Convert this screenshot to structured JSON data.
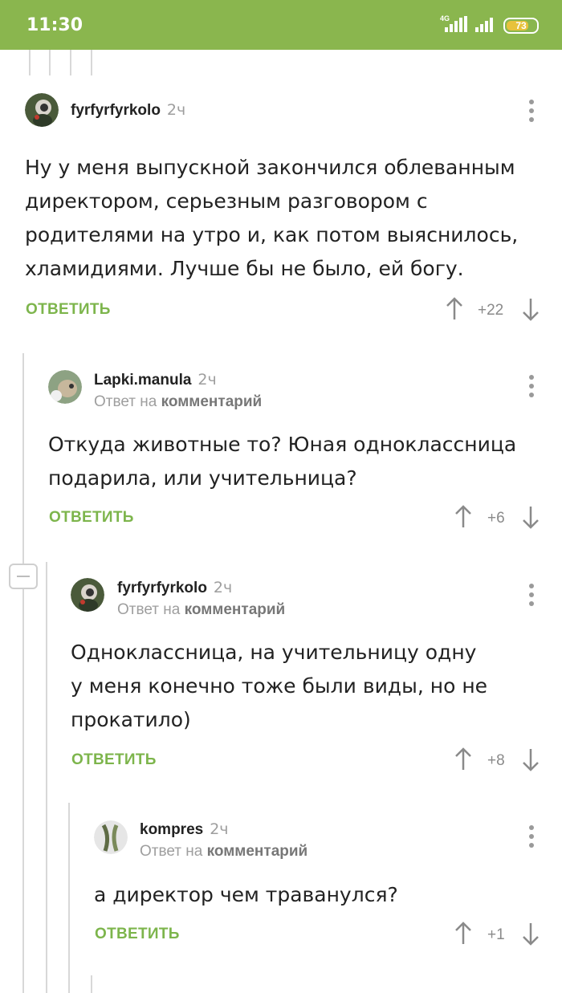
{
  "status": {
    "time": "11:30",
    "network": "4G",
    "battery": "73"
  },
  "comments": [
    {
      "user": "fyrfyrfyrkolo",
      "ago": "2ч",
      "reply_prefix": "",
      "reply_link": "",
      "text": [
        "Ну у меня выпускной закончился облеванным",
        "директором, серьезным разговором с",
        "родителями на утро и, как потом выяснилось,",
        "хламидиями. Лучше бы не было, ей богу."
      ],
      "answer": "ОТВЕТИТЬ",
      "rating": "+22"
    },
    {
      "user": "Lapki.manula",
      "ago": "2ч",
      "reply_prefix": "Ответ на",
      "reply_link": "комментарий",
      "text": [
        "Откуда животные то? Юная одноклассница",
        "подарила, или учительница?"
      ],
      "answer": "ОТВЕТИТЬ",
      "rating": "+6"
    },
    {
      "user": "fyrfyrfyrkolo",
      "ago": "2ч",
      "reply_prefix": "Ответ на",
      "reply_link": "комментарий",
      "text": [
        "Одноклассница, на учительницу одну",
        "у меня конечно тоже были виды, но не",
        "прокатило)"
      ],
      "answer": "ОТВЕТИТЬ",
      "rating": "+8"
    },
    {
      "user": "kompres",
      "ago": "2ч",
      "reply_prefix": "Ответ на",
      "reply_link": "комментарий",
      "text": [
        "а директор чем траванулся?"
      ],
      "answer": "ОТВЕТИТЬ",
      "rating": "+1"
    }
  ]
}
